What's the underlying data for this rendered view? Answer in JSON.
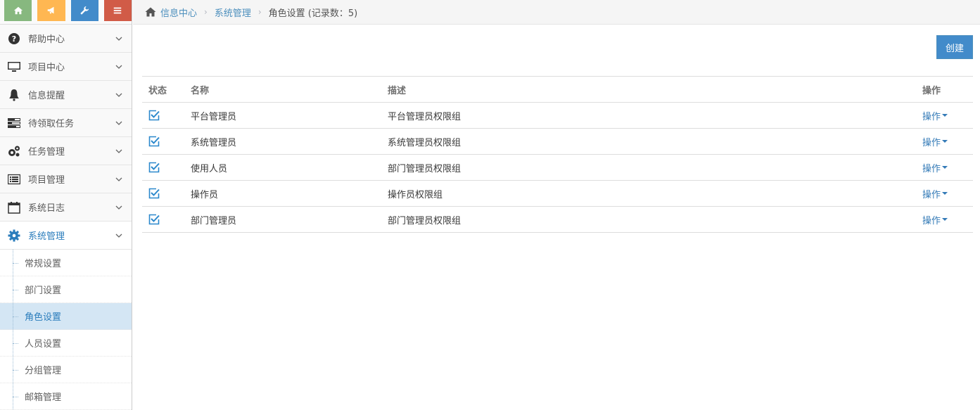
{
  "shortcuts": [
    {
      "icon": "home-icon",
      "color": "#87b87f"
    },
    {
      "icon": "bullhorn-icon",
      "color": "#ffb752"
    },
    {
      "icon": "wrench-icon",
      "color": "#6fb3e0"
    },
    {
      "icon": "menu-icon",
      "color": "#d15b47"
    }
  ],
  "nav": [
    {
      "label": "帮助中心",
      "icon": "question-circle-icon"
    },
    {
      "label": "项目中心",
      "icon": "desktop-icon"
    },
    {
      "label": "信息提醒",
      "icon": "bell-icon"
    },
    {
      "label": "待领取任务",
      "icon": "tasks-icon"
    },
    {
      "label": "任务管理",
      "icon": "cogs-icon"
    },
    {
      "label": "项目管理",
      "icon": "list-alt-icon"
    },
    {
      "label": "系统日志",
      "icon": "calendar-icon"
    },
    {
      "label": "系统管理",
      "icon": "cog-icon"
    }
  ],
  "subnav": [
    {
      "label": "常规设置"
    },
    {
      "label": "部门设置"
    },
    {
      "label": "角色设置"
    },
    {
      "label": "人员设置"
    },
    {
      "label": "分组管理"
    },
    {
      "label": "邮箱管理"
    }
  ],
  "breadcrumb": {
    "home": "信息中心",
    "section": "系统管理",
    "current": "角色设置 (记录数：5)"
  },
  "create_label": "创建",
  "table": {
    "headers": {
      "status": "状态",
      "name": "名称",
      "desc": "描述",
      "op": "操作"
    },
    "rows": [
      {
        "name": "平台管理员",
        "desc": "平台管理员权限组",
        "op": "操作",
        "checked": true
      },
      {
        "name": "系统管理员",
        "desc": "系统管理员权限组",
        "op": "操作",
        "checked": true
      },
      {
        "name": "使用人员",
        "desc": "部门管理员权限组",
        "op": "操作",
        "checked": true
      },
      {
        "name": "操作员",
        "desc": "操作员权限组",
        "op": "操作",
        "checked": true
      },
      {
        "name": "部门管理员",
        "desc": "部门管理员权限组",
        "op": "操作",
        "checked": true
      }
    ]
  },
  "colors": {
    "accent": "#428bca",
    "link": "#337ab7",
    "active_sub_bg": "#d4e6f4",
    "check": "#2b88cc"
  }
}
